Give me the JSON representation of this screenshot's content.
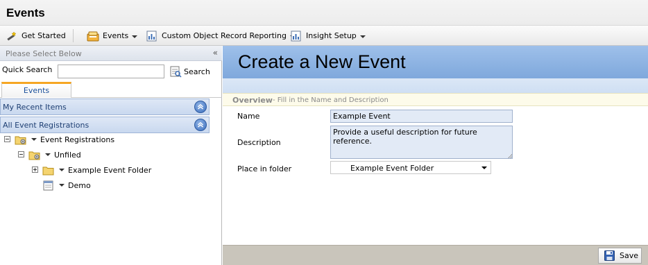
{
  "header": {
    "title": "Events"
  },
  "toolbar": {
    "get_started": "Get Started",
    "events": "Events",
    "custom_reporting": "Custom Object Record Reporting",
    "insight_setup": "Insight Setup"
  },
  "left_panel": {
    "heading": "Please Select Below",
    "collapse_glyph": "«",
    "quick_search_label": "Quick Search",
    "quick_search_value": "",
    "search_button": "Search",
    "tab": "Events",
    "sections": {
      "recent": "My Recent Items",
      "all_registrations": "All Event Registrations"
    },
    "tree": [
      {
        "label": "Event Registrations",
        "icon": "folder-gear-icon",
        "expander": "minus"
      },
      {
        "label": "Unfiled",
        "icon": "folder-gear-icon",
        "expander": "minus"
      },
      {
        "label": "Example Event Folder",
        "icon": "folder-icon",
        "expander": "plus"
      },
      {
        "label": "Demo",
        "icon": "report-icon",
        "expander": "none"
      }
    ]
  },
  "main": {
    "title": "Create a New Event",
    "overview_title": "Overview",
    "overview_subtitle": "-  Fill in the Name and Description",
    "form": {
      "name_label": "Name",
      "name_value": "Example Event",
      "description_label": "Description",
      "description_value": "Provide a useful description for future reference.",
      "folder_label": "Place in folder",
      "folder_value": "Example Event Folder"
    },
    "save_button": "Save"
  },
  "colors": {
    "banner": "#8fb4e4",
    "tab_accent": "#f5a623",
    "section_bar": "#d3dff2",
    "footer": "#c9c5bb"
  }
}
